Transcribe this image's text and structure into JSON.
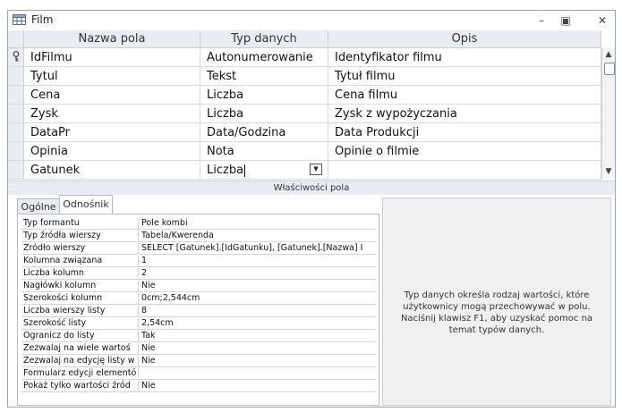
{
  "window": {
    "title": "Film"
  },
  "grid": {
    "headers": [
      "Nazwa pola",
      "Typ danych",
      "Opis"
    ],
    "rows": [
      {
        "name": "IdFilmu",
        "type": "Autonumerowanie",
        "desc": "Identyfikator filmu",
        "key": true
      },
      {
        "name": "Tytul",
        "type": "Tekst",
        "desc": "Tytuł filmu",
        "key": false
      },
      {
        "name": "Cena",
        "type": "Liczba",
        "desc": "Cena filmu",
        "key": false
      },
      {
        "name": "Zysk",
        "type": "Liczba",
        "desc": "Zysk z wypożyczania",
        "key": false
      },
      {
        "name": "DataPr",
        "type": "Data/Godzina",
        "desc": "Data Produkcji",
        "key": false
      },
      {
        "name": "Opinia",
        "type": "Nota",
        "desc": "Opinie o filmie",
        "key": false
      },
      {
        "name": "Gatunek",
        "type": "Liczba",
        "desc": "",
        "key": false
      }
    ]
  },
  "properties": {
    "band_label": "Właściwości pola",
    "tabs": [
      "Ogólne",
      "Odnośnik"
    ],
    "active_tab": "Odnośnik",
    "rows": [
      {
        "label": "Typ formantu",
        "value": "Pole kombi"
      },
      {
        "label": "Typ źródła wierszy",
        "value": "Tabela/Kwerenda"
      },
      {
        "label": "Źródło wierszy",
        "value": "SELECT [Gatunek].[IdGatunku], [Gatunek].[Nazwa] I"
      },
      {
        "label": "Kolumna związana",
        "value": "1"
      },
      {
        "label": "Liczba kolumn",
        "value": "2"
      },
      {
        "label": "Nagłówki kolumn",
        "value": "Nie"
      },
      {
        "label": "Szerokości kolumn",
        "value": "0cm;2,544cm"
      },
      {
        "label": "Liczba wierszy listy",
        "value": "8"
      },
      {
        "label": "Szerokość listy",
        "value": "2,54cm"
      },
      {
        "label": "Ogranicz do listy",
        "value": "Tak"
      },
      {
        "label": "Zezwalaj na wiele wartoś",
        "value": "Nie"
      },
      {
        "label": "Zezwalaj na edycję listy w",
        "value": "Nie"
      },
      {
        "label": "Formularz edycji elementó",
        "value": ""
      },
      {
        "label": "Pokaż tylko wartości źród",
        "value": "Nie"
      }
    ],
    "help_text": "Typ danych określa rodzaj wartości, które użytkownicy mogą przechowywać w polu. Naciśnij klawisz F1, aby uzyskać pomoc na temat typów danych."
  }
}
